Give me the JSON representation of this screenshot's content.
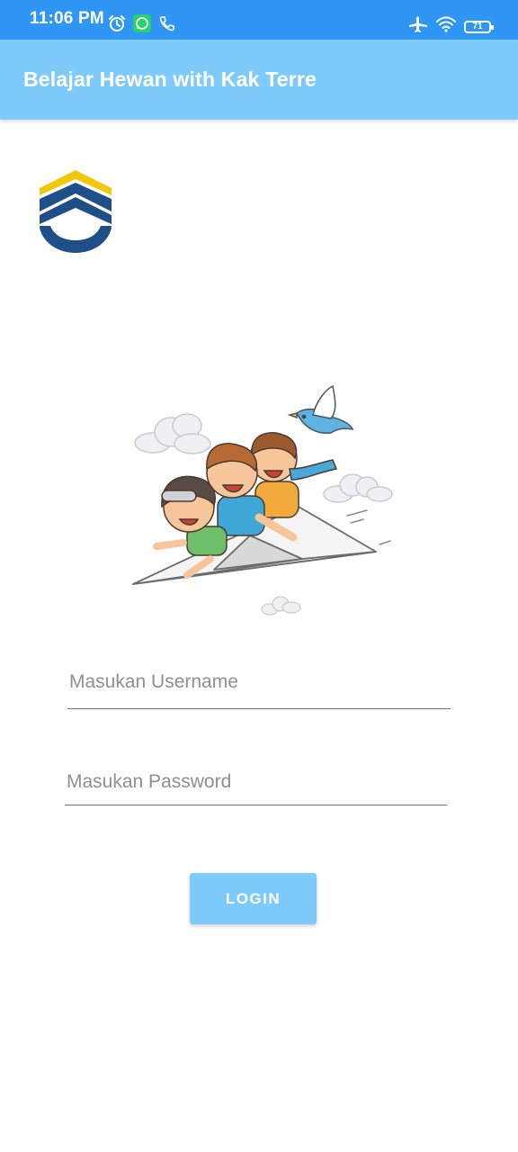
{
  "status_bar": {
    "time": "11:06 PM",
    "battery_level": "71"
  },
  "app_bar": {
    "title": "Belajar Hewan with Kak Terre"
  },
  "form": {
    "username_placeholder": "Masukan Username",
    "password_placeholder": "Masukan Password",
    "login_label": "LOGIN"
  },
  "colors": {
    "status_bar": "#2f96f3",
    "app_bar": "#7ecbfb",
    "button": "#7ecbfb"
  }
}
